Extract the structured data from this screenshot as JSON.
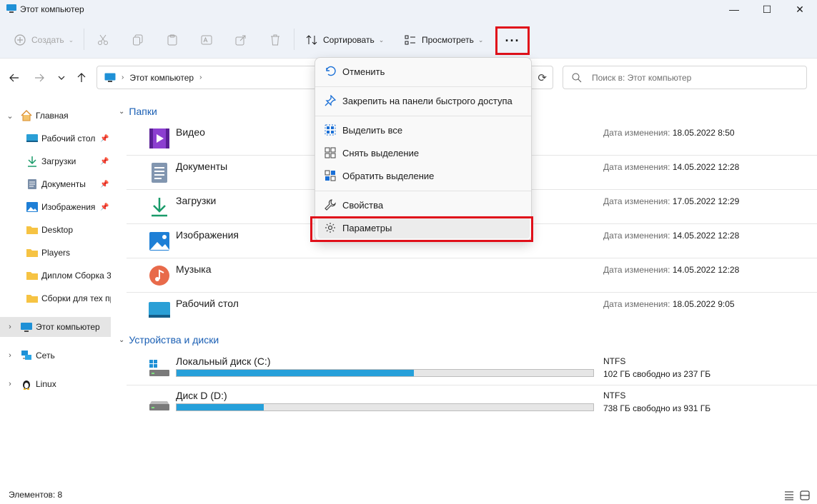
{
  "window": {
    "title": "Этот компьютер",
    "minimize_glyph": "—",
    "maximize_glyph": "☐",
    "close_glyph": "✕"
  },
  "toolbar": {
    "create_label": "Создать",
    "sort_label": "Сортировать",
    "view_label": "Просмотреть",
    "more_label": "···"
  },
  "nav": {
    "address_label": "Этот компьютер",
    "search_placeholder": "Поиск в: Этот компьютер"
  },
  "sidebar": {
    "home": "Главная",
    "quick": [
      {
        "label": "Рабочий стол",
        "icon": "desktop-icon"
      },
      {
        "label": "Загрузки",
        "icon": "download-icon"
      },
      {
        "label": "Документы",
        "icon": "document-icon"
      },
      {
        "label": "Изображения",
        "icon": "pictures-icon"
      },
      {
        "label": "Desktop",
        "icon": "folder-icon"
      },
      {
        "label": "Players",
        "icon": "folder-icon"
      },
      {
        "label": "Диплом Сборка 3",
        "icon": "folder-icon"
      },
      {
        "label": "Сборки для тех пр",
        "icon": "folder-icon"
      }
    ],
    "this_pc": "Этот компьютер",
    "network": "Сеть",
    "linux": "Linux"
  },
  "content": {
    "folders_header": "Папки",
    "date_prefix": "Дата изменения:",
    "folders": [
      {
        "name": "Видео",
        "date": "18.05.2022 8:50",
        "icon": "video-icon"
      },
      {
        "name": "Документы",
        "date": "14.05.2022 12:28",
        "icon": "documents-icon"
      },
      {
        "name": "Загрузки",
        "date": "17.05.2022 12:29",
        "icon": "downloads-icon"
      },
      {
        "name": "Изображения",
        "date": "14.05.2022 12:28",
        "icon": "pictures-icon"
      },
      {
        "name": "Музыка",
        "date": "14.05.2022 12:28",
        "icon": "music-icon"
      },
      {
        "name": "Рабочий стол",
        "date": "18.05.2022 9:05",
        "icon": "desktop-icon"
      }
    ],
    "devices_header": "Устройства и диски",
    "drives": [
      {
        "name": "Локальный диск (C:)",
        "fs": "NTFS",
        "free": "102 ГБ свободно из 237 ГБ",
        "used_fraction": 0.57
      },
      {
        "name": "Диск D (D:)",
        "fs": "NTFS",
        "free": "738 ГБ свободно из 931 ГБ",
        "used_fraction": 0.21
      }
    ]
  },
  "menu": {
    "undo": "Отменить",
    "pin": "Закрепить на панели быстрого доступа",
    "select_all": "Выделить все",
    "select_none": "Снять выделение",
    "invert": "Обратить выделение",
    "properties": "Свойства",
    "options": "Параметры"
  },
  "status": {
    "items": "Элементов: 8"
  },
  "colors": {
    "accent": "#1a5fb4",
    "highlight_box": "#e0101a",
    "drive_fill": "#26a0da"
  }
}
